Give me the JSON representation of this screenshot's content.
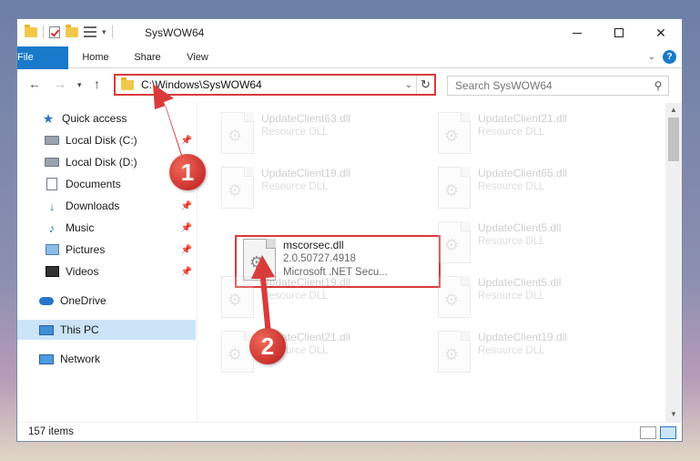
{
  "window": {
    "title": "SysWOW64",
    "controls": {
      "minimize": "",
      "maximize": "",
      "close": "✕"
    }
  },
  "ribbon": {
    "tabs": [
      {
        "label": "File"
      },
      {
        "label": "Home"
      },
      {
        "label": "Share"
      },
      {
        "label": "View"
      }
    ],
    "help": "?"
  },
  "address_bar": {
    "path": "C:\\Windows\\SysWOW64",
    "search_placeholder": "Search SysWOW64"
  },
  "nav_pane": {
    "items": [
      {
        "label": "Quick access",
        "icon": "star-icon"
      },
      {
        "label": "Local Disk (C:)",
        "icon": "disk-icon",
        "pinned": true
      },
      {
        "label": "Local Disk (D:)",
        "icon": "disk-icon"
      },
      {
        "label": "Documents",
        "icon": "documents-icon",
        "pinned": true
      },
      {
        "label": "Downloads",
        "icon": "downloads-icon",
        "pinned": true
      },
      {
        "label": "Music",
        "icon": "music-icon",
        "pinned": true
      },
      {
        "label": "Pictures",
        "icon": "pictures-icon",
        "pinned": true
      },
      {
        "label": "Videos",
        "icon": "videos-icon",
        "pinned": true
      },
      {
        "label": "OneDrive",
        "icon": "onedrive-icon"
      },
      {
        "label": "This PC",
        "icon": "this-pc-icon",
        "selected": true
      },
      {
        "label": "Network",
        "icon": "network-icon"
      }
    ]
  },
  "files": [
    {
      "name": "UpdateClient63.dll",
      "subtitle": "Resource DLL"
    },
    {
      "name": "UpdateClient21.dll",
      "subtitle": "Resource DLL"
    },
    {
      "name": "UpdateClient19.dll",
      "subtitle": "Resource DLL"
    },
    {
      "name": "UpdateClient65.dll",
      "subtitle": "Resource DLL"
    },
    {
      "name": "mscorsec.dll",
      "version": "2.0.50727.4918",
      "subtitle": "Microsoft .NET Secu...",
      "highlighted": true
    },
    {
      "name": "UpdateClient5.dll",
      "subtitle": "Resource DLL"
    },
    {
      "name": "UpdateClient19.dll",
      "subtitle": "Resource DLL"
    },
    {
      "name": "UpdateClient5.dll",
      "subtitle": "Resource DLL"
    },
    {
      "name": "UpdateClient21.dll",
      "subtitle": "Resource DLL"
    },
    {
      "name": "UpdateClient19.dll",
      "subtitle": "Resource DLL"
    }
  ],
  "status_bar": {
    "item_count": "157 items"
  },
  "callouts": [
    {
      "number": "1"
    },
    {
      "number": "2"
    }
  ],
  "colors": {
    "accent": "#1979ca",
    "callout_red": "#d93b3b",
    "selection": "#cce4f7"
  }
}
